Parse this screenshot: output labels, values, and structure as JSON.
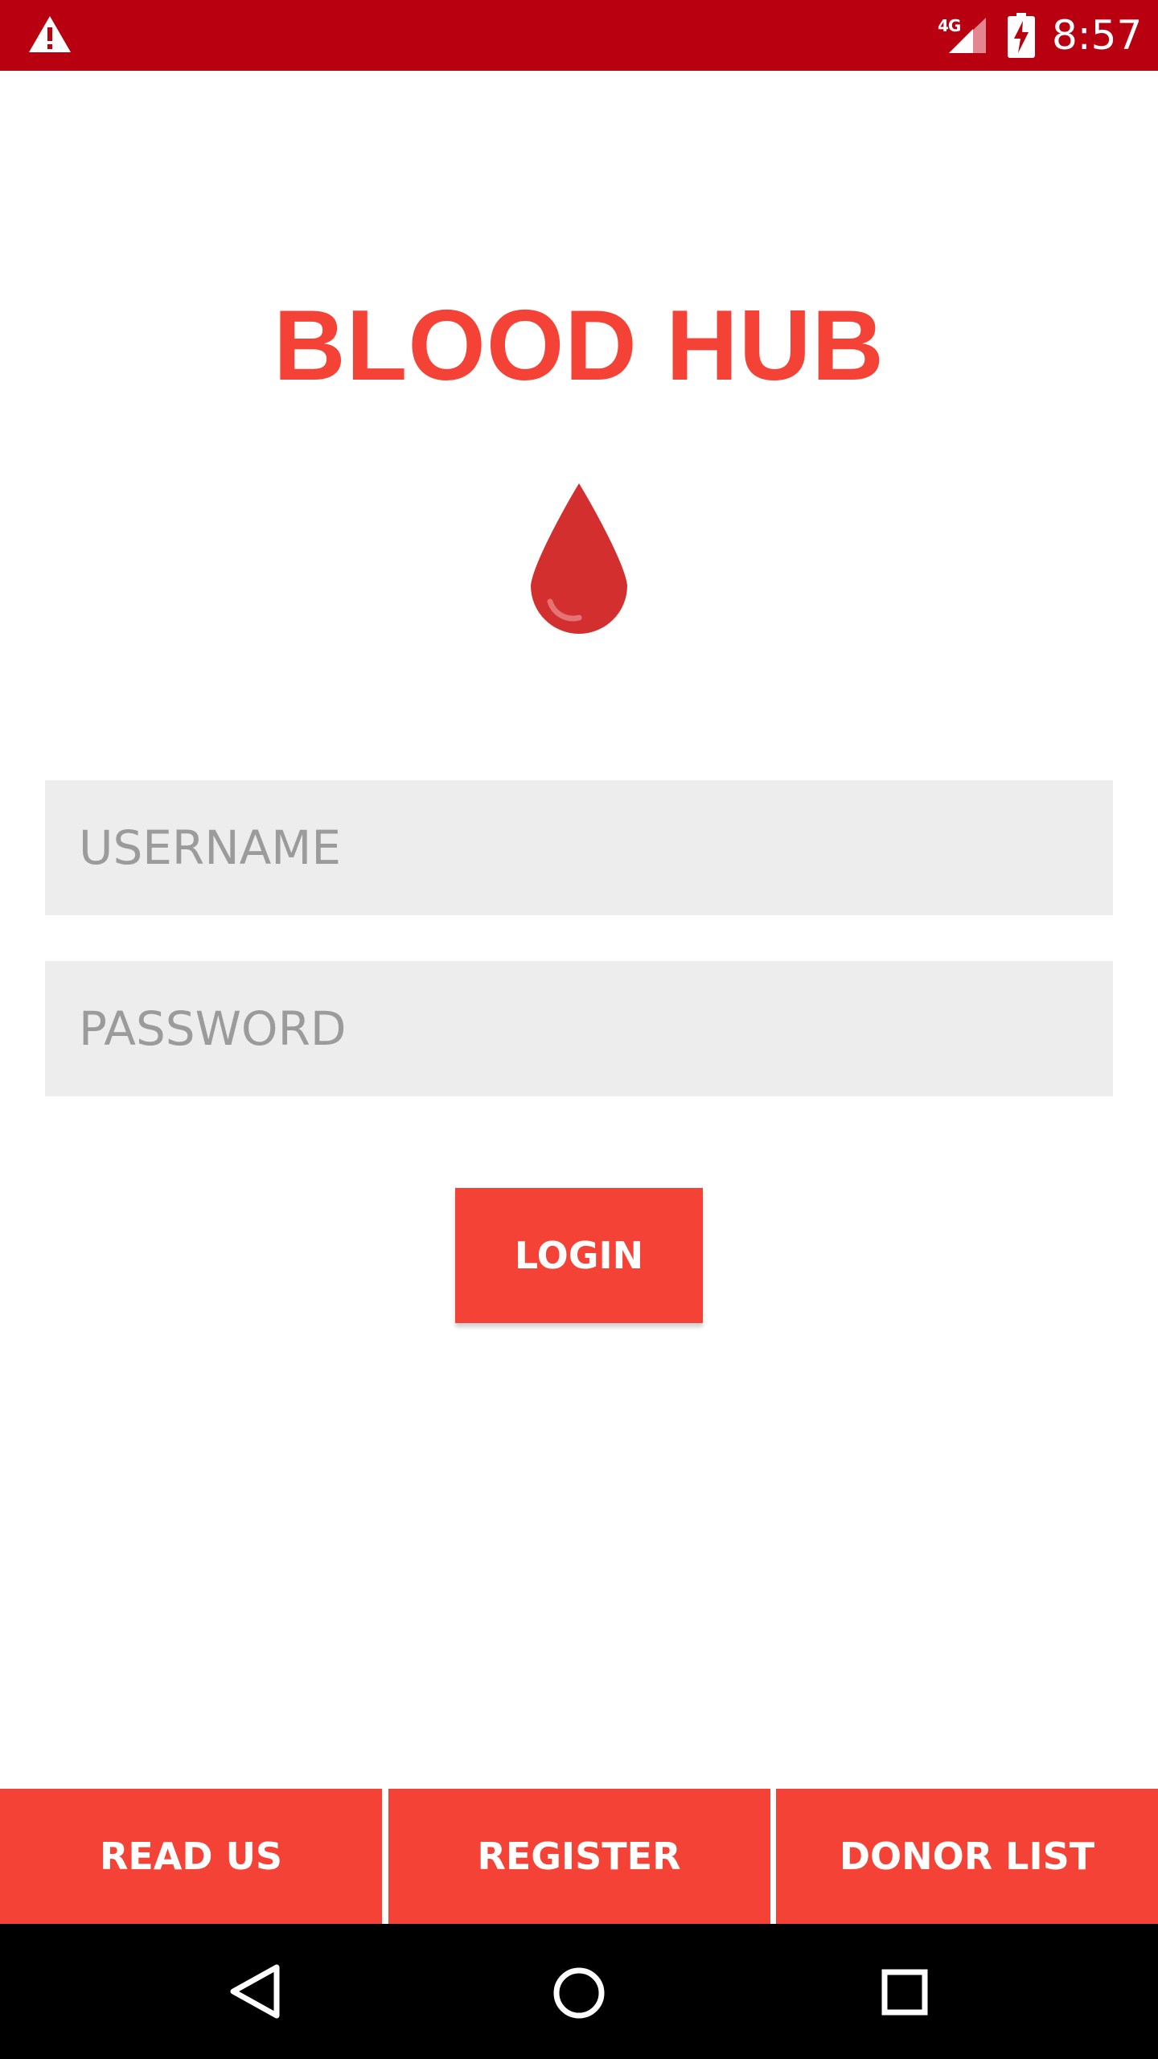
{
  "status_bar": {
    "network_label": "4G",
    "time": "8:57",
    "icons": [
      "warning-icon",
      "signal-icon",
      "battery-charging-icon"
    ]
  },
  "app": {
    "title": "BLOOD HUB",
    "logo_icon": "blood-drop-icon"
  },
  "form": {
    "username_placeholder": "USERNAME",
    "username_value": "",
    "password_placeholder": "PASSWORD",
    "password_value": "",
    "login_label": "LOGIN"
  },
  "bottom_tabs": [
    {
      "label": "READ US"
    },
    {
      "label": "REGISTER"
    },
    {
      "label": "DONOR LIST"
    }
  ],
  "nav_bar": {
    "icons": [
      "back-icon",
      "home-icon",
      "recents-icon"
    ]
  },
  "colors": {
    "status_bar": "#b90010",
    "accent": "#f44336",
    "drop": "#d32f2f",
    "field_background": "#ededed",
    "placeholder": "#9b9b9b"
  }
}
